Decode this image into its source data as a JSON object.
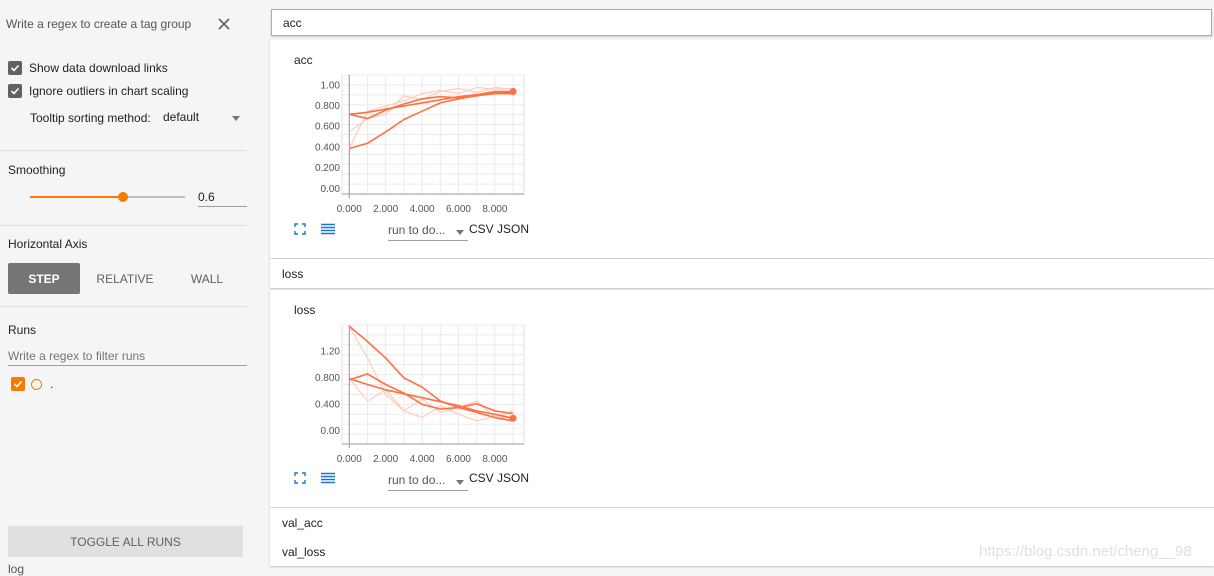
{
  "sidebar": {
    "tag_regex_placeholder": "Write a regex to create a tag group",
    "show_download_links": "Show data download links",
    "ignore_outliers": "Ignore outliers in chart scaling",
    "tooltip_sort_label": "Tooltip sorting method:",
    "tooltip_sort_value": "default",
    "smoothing_title": "Smoothing",
    "smoothing_value": "0.6",
    "smoothing_fraction": 0.6,
    "horizontal_axis_title": "Horizontal Axis",
    "axis_buttons": [
      "STEP",
      "RELATIVE",
      "WALL"
    ],
    "runs_title": "Runs",
    "runs_filter_placeholder": "Write a regex to filter runs",
    "run_name": ".",
    "toggle_all_runs": "TOGGLE ALL RUNS",
    "log_text": "log"
  },
  "main": {
    "tag_search_value": "acc",
    "categories": [
      "acc",
      "loss",
      "val_acc",
      "val_loss"
    ],
    "run_select_label": "run to do...",
    "csv_label": "CSV",
    "json_label": "JSON",
    "watermark": "https://blog.csdn.net/cheng__98"
  },
  "colors": {
    "accent": "#f57c00",
    "series": "#ff7043",
    "series_raw": "#ffccbc",
    "button_active": "#757575"
  },
  "chart_data": [
    {
      "type": "line",
      "title": "acc",
      "x_ticks": [
        "0.000",
        "2.000",
        "4.000",
        "6.000",
        "8.000"
      ],
      "y_ticks": [
        "0.00",
        "0.200",
        "0.400",
        "0.600",
        "0.800",
        "1.00"
      ],
      "xlim": [
        -0.4,
        9.6
      ],
      "ylim": [
        -0.05,
        1.1
      ],
      "series": [
        {
          "x": [
            0,
            1,
            2,
            3,
            4,
            5,
            6,
            7,
            8,
            9
          ],
          "y": [
            0.72,
            0.68,
            0.76,
            0.82,
            0.87,
            0.89,
            0.88,
            0.9,
            0.92,
            0.92
          ],
          "style": "smoothed"
        },
        {
          "x": [
            0,
            1,
            2,
            3,
            4,
            5,
            6,
            7,
            8,
            9
          ],
          "y": [
            0.39,
            0.44,
            0.55,
            0.67,
            0.75,
            0.83,
            0.87,
            0.9,
            0.93,
            0.93
          ],
          "style": "smoothed"
        },
        {
          "x": [
            0,
            1,
            2,
            3,
            4,
            5,
            6,
            7,
            8,
            9
          ],
          "y": [
            0.72,
            0.74,
            0.77,
            0.8,
            0.83,
            0.86,
            0.89,
            0.91,
            0.94,
            0.94
          ],
          "style": "smoothed"
        },
        {
          "x": [
            0,
            1,
            2,
            3,
            4,
            5,
            6,
            7,
            8,
            9
          ],
          "y": [
            0.39,
            0.75,
            0.8,
            0.85,
            0.92,
            0.95,
            0.92,
            0.98,
            0.96,
            0.97
          ],
          "style": "raw"
        },
        {
          "x": [
            0,
            1,
            2,
            3,
            4,
            5,
            6,
            7,
            8,
            9
          ],
          "y": [
            0.55,
            0.68,
            0.72,
            0.9,
            0.86,
            0.94,
            0.97,
            0.93,
            0.98,
            0.96
          ],
          "style": "raw"
        }
      ]
    },
    {
      "type": "line",
      "title": "loss",
      "x_ticks": [
        "0.000",
        "2.000",
        "4.000",
        "6.000",
        "8.000"
      ],
      "y_ticks": [
        "0.00",
        "0.400",
        "0.800",
        "1.20"
      ],
      "xlim": [
        -0.4,
        9.6
      ],
      "ylim": [
        -0.2,
        1.6
      ],
      "series": [
        {
          "x": [
            0,
            1,
            2,
            3,
            4,
            5,
            6,
            7,
            8,
            9
          ],
          "y": [
            1.58,
            1.35,
            1.1,
            0.8,
            0.66,
            0.45,
            0.35,
            0.28,
            0.2,
            0.15
          ],
          "style": "smoothed"
        },
        {
          "x": [
            0,
            1,
            2,
            3,
            4,
            5,
            6,
            7,
            8,
            9
          ],
          "y": [
            0.77,
            0.86,
            0.7,
            0.57,
            0.4,
            0.33,
            0.35,
            0.41,
            0.3,
            0.26
          ],
          "style": "smoothed"
        },
        {
          "x": [
            0,
            1,
            2,
            3,
            4,
            5,
            6,
            7,
            8,
            9
          ],
          "y": [
            0.79,
            0.7,
            0.62,
            0.56,
            0.5,
            0.44,
            0.38,
            0.3,
            0.25,
            0.19
          ],
          "style": "smoothed"
        },
        {
          "x": [
            0,
            1,
            2,
            3,
            4,
            5,
            6,
            7,
            8,
            9
          ],
          "y": [
            1.58,
            1.1,
            0.55,
            0.3,
            0.2,
            0.38,
            0.25,
            0.15,
            0.22,
            0.18
          ],
          "style": "raw"
        },
        {
          "x": [
            0,
            1,
            2,
            3,
            4,
            5,
            6,
            7,
            8,
            9
          ],
          "y": [
            0.79,
            0.45,
            0.62,
            0.3,
            0.48,
            0.28,
            0.35,
            0.45,
            0.2,
            0.3
          ],
          "style": "raw"
        }
      ]
    }
  ]
}
